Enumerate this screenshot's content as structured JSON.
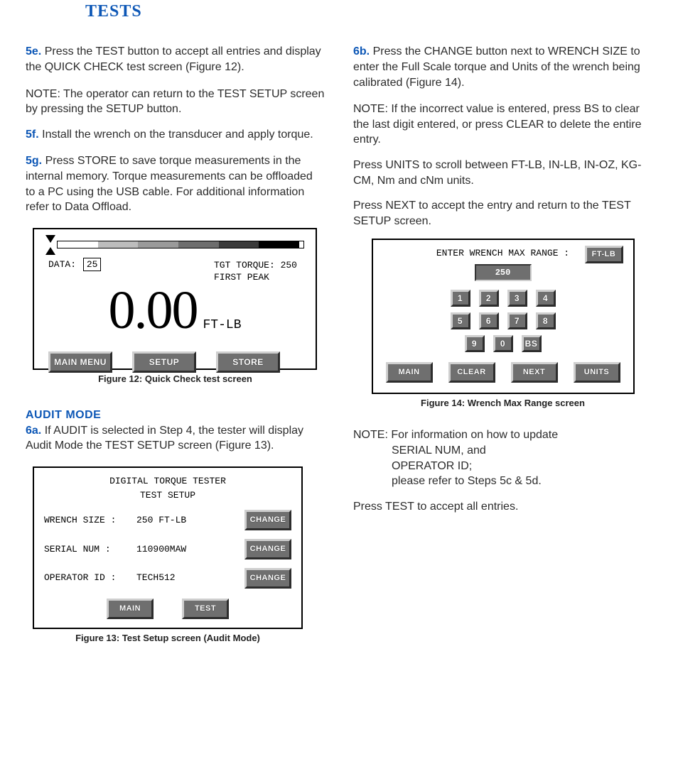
{
  "title": "TESTS",
  "left": {
    "step5e": {
      "num": "5e.",
      "text": "Press the TEST button to accept all entries and display the QUICK CHECK test screen (Figure 12)."
    },
    "note1_prefix": "NOTE:",
    "note1_body": "The operator can return to the TEST SETUP screen by pressing the SETUP button.",
    "step5f": {
      "num": "5f.",
      "text": "Install the wrench on the transducer and apply torque."
    },
    "step5g": {
      "num": "5g.",
      "text": "Press STORE to save torque measurements in the internal memory. Torque measurements can be offloaded to a PC using the USB cable. For additional information refer to Data Offload."
    },
    "fig12": {
      "data_label": "DATA:",
      "data_value": "25",
      "tgt_label": "TGT TORQUE: 250",
      "peak_label": "FIRST PEAK",
      "reading": "0.00",
      "unit": "FT-LB",
      "buttons": {
        "main": "MAIN MENU",
        "setup": "SETUP",
        "store": "STORE"
      },
      "caption": "Figure 12: Quick Check test screen"
    },
    "audit_head": "AUDIT MODE",
    "step6a": {
      "num": "6a.",
      "text": "If AUDIT is selected in Step 4, the tester will display Audit Mode the TEST SETUP screen (Figure 13)."
    },
    "fig13": {
      "title1": "DIGITAL TORQUE TESTER",
      "title2": "TEST SETUP",
      "rows": {
        "wrench": {
          "label": "WRENCH SIZE  :",
          "value": "250 FT-LB"
        },
        "serial": {
          "label": "SERIAL NUM   :",
          "value": "110900MAW"
        },
        "oper": {
          "label": "OPERATOR ID  :",
          "value": "TECH512"
        }
      },
      "change": "CHANGE",
      "main": "MAIN",
      "test": "TEST",
      "caption": "Figure 13: Test Setup screen (Audit Mode)"
    }
  },
  "right": {
    "step6b": {
      "num": "6b.",
      "text": "Press the CHANGE button next to WRENCH SIZE to enter the Full Scale torque and Units of the wrench being calibrated (Figure 14)."
    },
    "note2_prefix": "NOTE:",
    "note2_body": "If the incorrect value is entered, press BS to clear the last digit entered, or press CLEAR to delete the entire entry.",
    "p_units": "Press UNITS to scroll between FT-LB, IN-LB, IN-OZ, KG-CM, Nm and cNm units.",
    "p_next": "Press NEXT to accept the entry and return to the TEST SETUP screen.",
    "fig14": {
      "head": "ENTER WRENCH MAX RANGE  :",
      "unit": "FT-LB",
      "entry": "250",
      "keys": {
        "r1": [
          "1",
          "2",
          "3",
          "4"
        ],
        "r2": [
          "5",
          "6",
          "7",
          "8"
        ],
        "r3": [
          "9",
          "0",
          "BS"
        ]
      },
      "main": "MAIN",
      "clear": "CLEAR",
      "next": "NEXT",
      "units": "UNITS",
      "caption": "Figure 14: Wrench Max Range screen"
    },
    "note3_prefix": "NOTE:",
    "note3_l1": "For information on how to update",
    "note3_l2": "SERIAL NUM, and",
    "note3_l3": "OPERATOR ID;",
    "note3_l4": "please refer to Steps 5c & 5d.",
    "p_test": "Press TEST to accept all entries."
  }
}
